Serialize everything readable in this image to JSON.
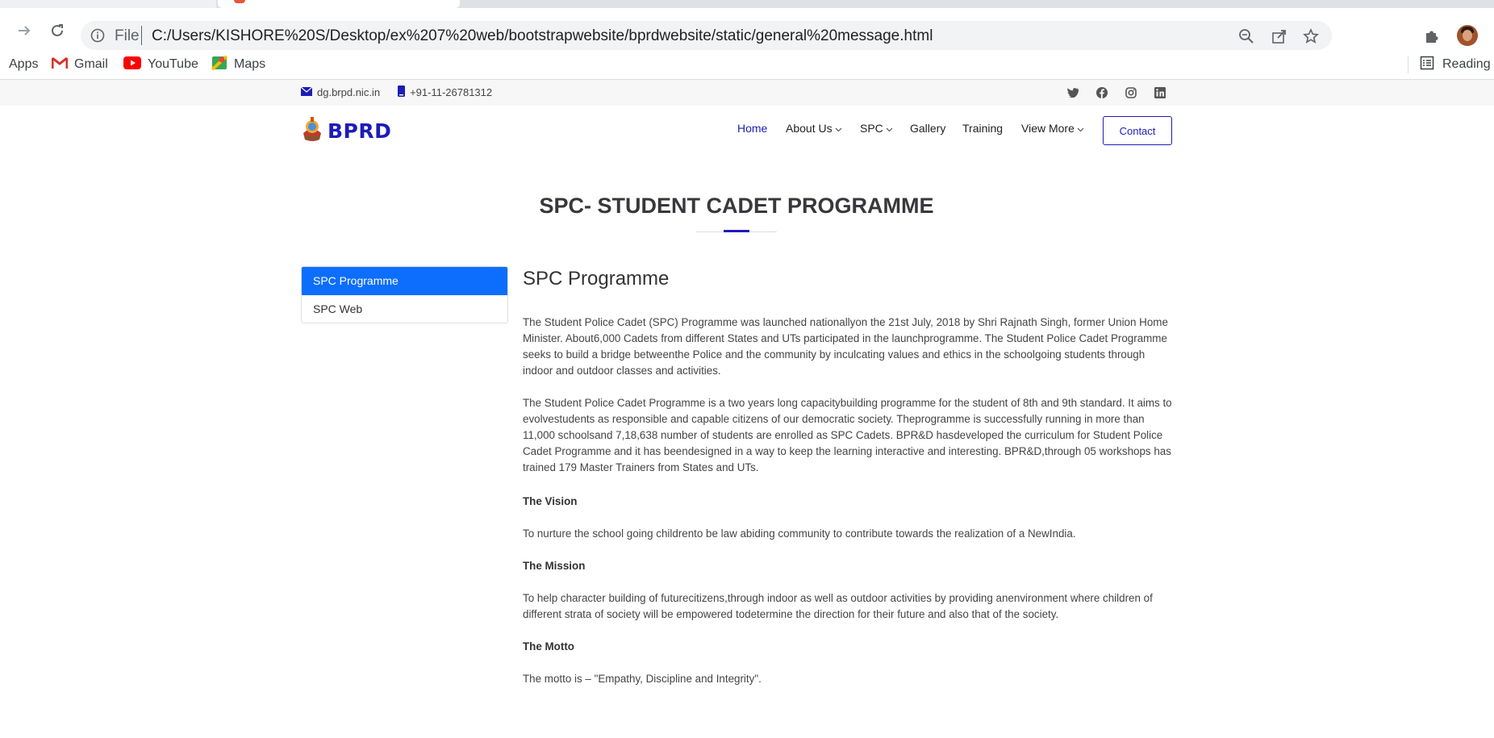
{
  "browser": {
    "url_scheme": "File",
    "url": "C:/Users/KISHORE%20S/Desktop/ex%207%20web/bootstrapwebsite/bprdwebsite/static/general%20message.html",
    "bookmarks": [
      {
        "label": "Apps",
        "icon": "apps-grid-icon"
      },
      {
        "label": "Gmail",
        "icon": "gmail-icon"
      },
      {
        "label": "YouTube",
        "icon": "youtube-icon"
      },
      {
        "label": "Maps",
        "icon": "maps-icon"
      }
    ],
    "reading_list_label": "Reading li"
  },
  "topbar": {
    "email": "dg.brpd.nic.in",
    "phone": "+91-11-26781312",
    "social": [
      "twitter-icon",
      "facebook-icon",
      "instagram-icon",
      "linkedin-icon"
    ]
  },
  "header": {
    "brand": "BPRD",
    "nav": [
      {
        "label": "Home",
        "active": true,
        "dropdown": false
      },
      {
        "label": "About Us",
        "active": false,
        "dropdown": true
      },
      {
        "label": "SPC",
        "active": false,
        "dropdown": true
      },
      {
        "label": "Gallery",
        "active": false,
        "dropdown": false
      },
      {
        "label": "Training",
        "active": false,
        "dropdown": false
      },
      {
        "label": "View More",
        "active": false,
        "dropdown": true
      }
    ],
    "contact_label": "Contact"
  },
  "page": {
    "title": "SPC- STUDENT CADET PROGRAMME",
    "sidebar": [
      {
        "label": "SPC Programme",
        "active": true
      },
      {
        "label": "SPC Web",
        "active": false
      }
    ],
    "heading": "SPC Programme",
    "paragraphs": [
      "The Student Police Cadet (SPC) Programme was launched nationallyon the 21st July, 2018 by Shri Rajnath Singh, former Union Home Minister. About6,000 Cadets from different States and UTs participated in the launchprogramme. The Student Police Cadet Programme seeks to build a bridge betweenthe Police and the community by inculcating values and ethics in the schoolgoing students through indoor and outdoor classes and activities.",
      "The Student Police Cadet Programme is a two years long capacitybuilding programme for the student of 8th and 9th standard. It aims to evolvestudents as responsible and capable citizens of our democratic society. Theprogramme is successfully running in more than 11,000 schoolsand 7,18,638 number of students are enrolled as SPC Cadets. BPR&D hasdeveloped the curriculum for Student Police Cadet Programme and it has beendesigned in a way to keep the learning interactive and interesting. BPR&D,through 05 workshops has trained 179 Master Trainers from States and UTs."
    ],
    "vision_heading": "The Vision",
    "vision_text": "To nurture the school going childrento be law abiding community to contribute towards the realization of a NewIndia.",
    "mission_heading": "The Mission",
    "mission_text": "To help character building of futurecitizens,through indoor as well as outdoor activities by providing anenvironment where children of different strata of society will be empowered todetermine the direction for their future and also that of the society.",
    "motto_heading": "The Motto",
    "motto_text": "The motto is – \"Empathy, Discipline and Integrity\"."
  },
  "colors": {
    "accent": "#1c1cb8",
    "sidebar_active": "#0d6efd"
  }
}
